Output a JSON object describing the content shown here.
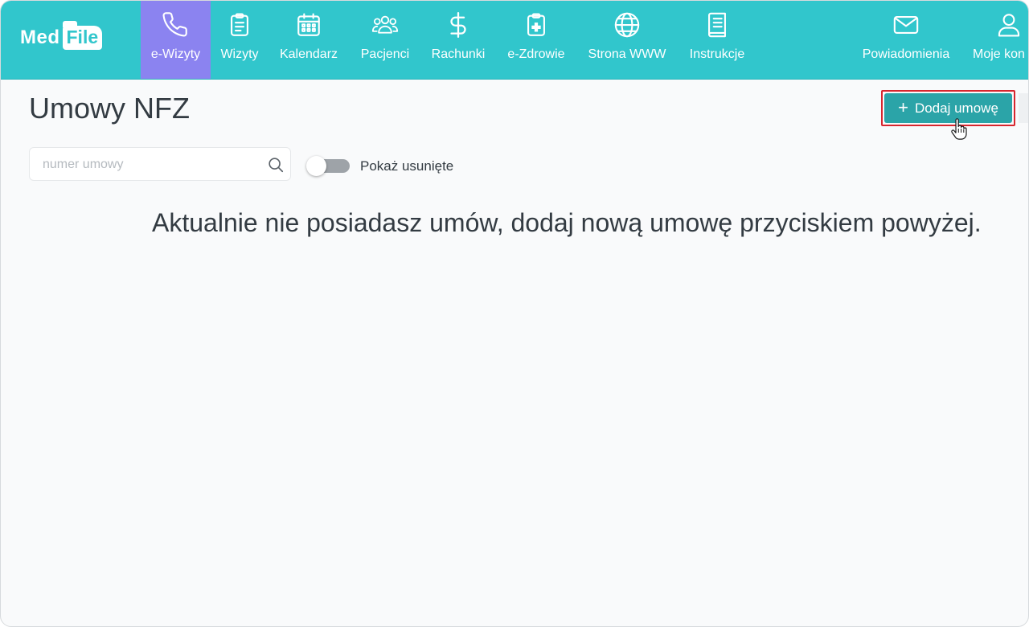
{
  "brand": {
    "logo_part1": "Med",
    "logo_part2": "File"
  },
  "nav": {
    "items": [
      {
        "label": "e-Wizyty",
        "icon": "phone-icon",
        "active": true
      },
      {
        "label": "Wizyty",
        "icon": "clipboard-icon"
      },
      {
        "label": "Kalendarz",
        "icon": "calendar-icon"
      },
      {
        "label": "Pacjenci",
        "icon": "users-icon"
      },
      {
        "label": "Rachunki",
        "icon": "dollar-icon"
      },
      {
        "label": "e-Zdrowie",
        "icon": "medical-clipboard-icon"
      },
      {
        "label": "Strona WWW",
        "icon": "globe-icon"
      },
      {
        "label": "Instrukcje",
        "icon": "book-icon"
      }
    ],
    "right_items": [
      {
        "label": "Powiadomienia",
        "icon": "envelope-icon"
      },
      {
        "label": "Moje kon",
        "icon": "user-icon"
      }
    ],
    "colors": {
      "bar": "#31c6cc",
      "active": "#8b83f0"
    }
  },
  "page": {
    "title": "Umowy NFZ",
    "add_button": {
      "label": "Dodaj umowę",
      "icon": "plus-icon",
      "color": "#2ba4a8",
      "highlight": "#d7262e"
    },
    "search": {
      "placeholder": "numer umowy",
      "value": ""
    },
    "toggle": {
      "label": "Pokaż usunięte",
      "checked": false
    },
    "empty_message": "Aktualnie nie posiadasz umów, dodaj nową umowę przyciskiem powyżej."
  }
}
